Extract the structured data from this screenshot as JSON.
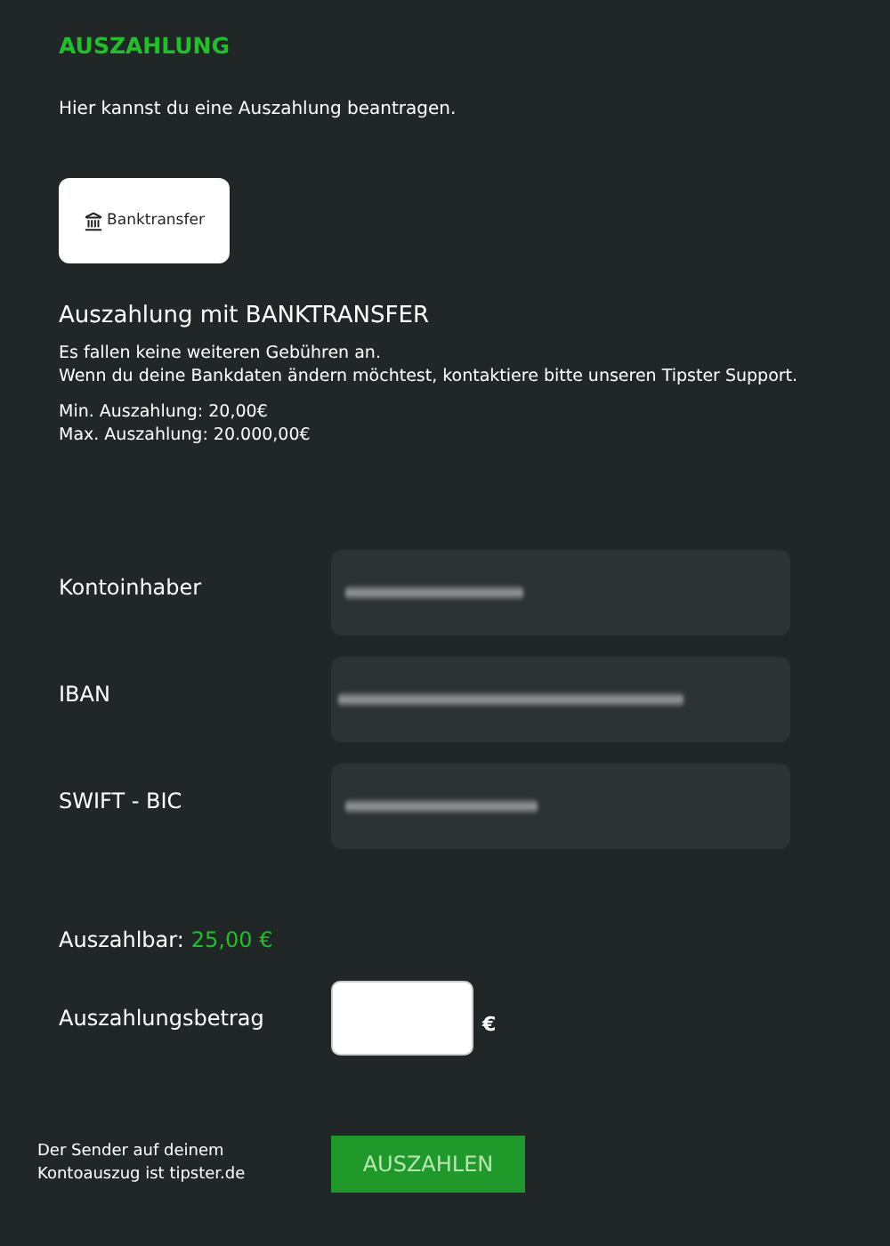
{
  "title": "AUSZAHLUNG",
  "intro": "Hier kannst du eine Auszahlung beantragen.",
  "methods": [
    {
      "label": "Banktransfer",
      "selected": true
    }
  ],
  "method_heading": "Auszahlung mit BANKTRANSFER",
  "notes": [
    "Es fallen keine weiteren Gebühren an.",
    "Wenn du deine Bankdaten ändern möchtest, kontaktiere bitte unseren Tipster Support."
  ],
  "limits": [
    "Min. Auszahlung: 20,00€",
    "Max. Auszahlung: 20.000,00€"
  ],
  "fields": [
    {
      "label": "Kontoinhaber"
    },
    {
      "label": "IBAN"
    },
    {
      "label": "SWIFT - BIC"
    }
  ],
  "available": {
    "label": "Auszahlbar:",
    "amount": "25,00 €"
  },
  "amount": {
    "label": "Auszahlungsbetrag",
    "currency": "€"
  },
  "footer_note": "Der Sender auf deinem Kontoauszug ist tipster.de",
  "submit": "AUSZAHLEN"
}
